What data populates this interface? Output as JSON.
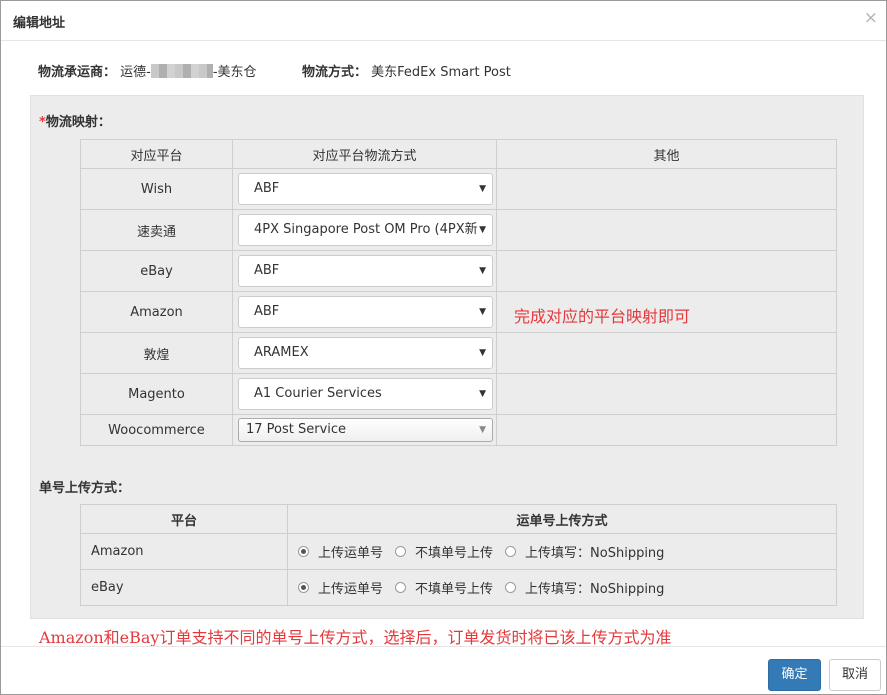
{
  "dialog": {
    "title": "编辑地址",
    "close_symbol": "×"
  },
  "info": {
    "carrier_label": "物流承运商：",
    "carrier_prefix": "运德-",
    "carrier_suffix": "-美东仓",
    "method_label": "物流方式：",
    "method_value": "美东FedEx Smart Post"
  },
  "mapping": {
    "required_mark": "*",
    "label": "物流映射：",
    "headers": [
      "对应平台",
      "对应平台物流方式",
      "其他"
    ],
    "rows": [
      {
        "platform": "Wish",
        "method": "ABF"
      },
      {
        "platform": "速卖通",
        "method": "4PX Singapore Post OM Pro (4PX新"
      },
      {
        "platform": "eBay",
        "method": "ABF"
      },
      {
        "platform": "Amazon",
        "method": "ABF"
      },
      {
        "platform": "敦煌",
        "method": "ARAMEX"
      },
      {
        "platform": "Magento",
        "method": "A1 Courier Services"
      },
      {
        "platform": "Woocommerce",
        "method": "17 Post Service"
      }
    ],
    "annotation": "完成对应的平台映射即可"
  },
  "upload": {
    "label": "单号上传方式：",
    "headers": [
      "平台",
      "运单号上传方式"
    ],
    "options": [
      "上传运单号",
      "不填单号上传",
      "上传填写：NoShipping"
    ],
    "rows": [
      {
        "platform": "Amazon",
        "selected": 0
      },
      {
        "platform": "eBay",
        "selected": 0
      }
    ],
    "annotation": "Amazon和eBay订单支持不同的单号上传方式，选择后，订单发货时将已该上传方式为准"
  },
  "footer": {
    "ok_label": "确定",
    "cancel_label": "取消"
  },
  "colors": {
    "primary_button": "#337ab7",
    "annotation_red": "#e4393c",
    "panel_bg": "#ececec"
  },
  "icons": {
    "close": "close-icon",
    "select_arrow": "chevron-down-icon"
  }
}
